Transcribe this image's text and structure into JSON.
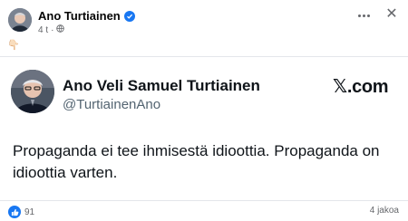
{
  "post": {
    "author": "Ano Turtiainen",
    "time": "4 t",
    "separator": "·",
    "audience_icon": "globe-icon",
    "emoji": "👇🏻"
  },
  "card": {
    "name": "Ano Veli Samuel Turtiainen",
    "handle": "@TurtiainenAno",
    "brand": "𝕏.com",
    "text": "Propaganda ei tee ihmisestä idioottia. Propaganda on idioottia varten."
  },
  "footer": {
    "reaction_count": "91",
    "shares": "4 jakoa"
  },
  "colors": {
    "accent": "#1877f2",
    "secondary_text": "#65676b"
  }
}
